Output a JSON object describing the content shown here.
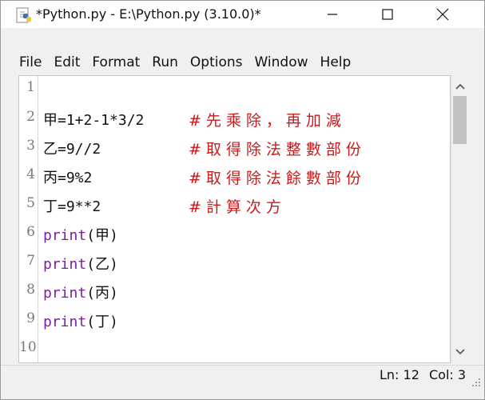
{
  "window": {
    "title": "*Python.py - E:\\Python.py (3.10.0)*",
    "controls": {
      "minimize_icon": "minimize-icon",
      "maximize_icon": "maximize-icon",
      "close_icon": "close-icon"
    }
  },
  "menu": [
    "File",
    "Edit",
    "Format",
    "Run",
    "Options",
    "Window",
    "Help"
  ],
  "editor": {
    "line_numbers": [
      "1",
      "2",
      "3",
      "4",
      "5",
      "6",
      "7",
      "8",
      "9",
      "10"
    ],
    "lines": [
      {
        "code": "",
        "comment": ""
      },
      {
        "code": "甲=1+2-1*3/2",
        "comment": "#先乘除，再加減"
      },
      {
        "code": "乙=9//2",
        "comment": "#取得除法整數部份"
      },
      {
        "code": "丙=9%2",
        "comment": "#取得除法餘數部份"
      },
      {
        "code": "丁=9**2",
        "comment": "#計算次方"
      },
      {
        "kw": "print",
        "args": "(甲)"
      },
      {
        "kw": "print",
        "args": "(乙)"
      },
      {
        "kw": "print",
        "args": "(丙)"
      },
      {
        "kw": "print",
        "args": "(丁)"
      },
      {
        "code": "",
        "comment": ""
      }
    ]
  },
  "status": {
    "line": "Ln: 12",
    "col": "Col: 3"
  },
  "colors": {
    "keyword": "#7a2299",
    "comment": "#cc1a1a",
    "text": "#111111"
  }
}
